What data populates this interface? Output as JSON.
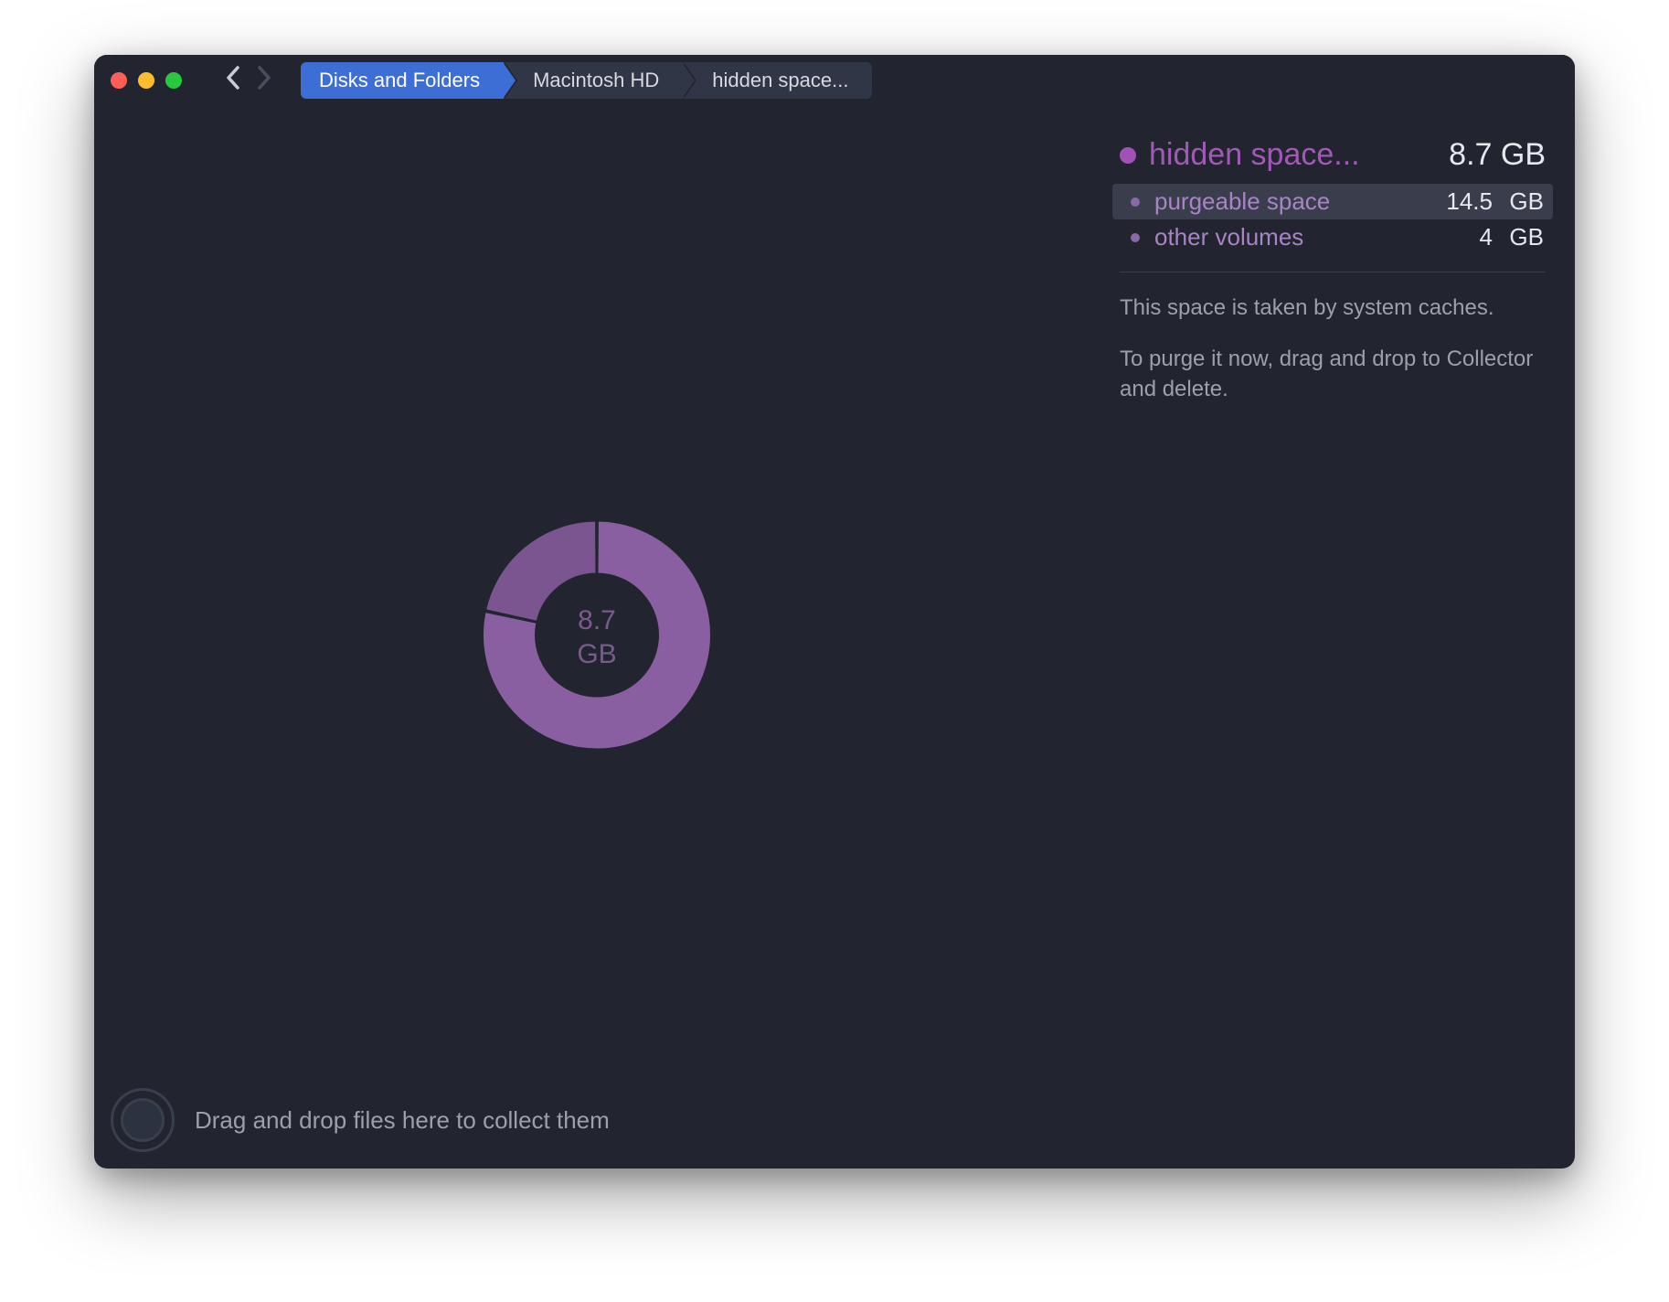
{
  "breadcrumb": {
    "items": [
      {
        "label": "Disks and Folders",
        "active": true
      },
      {
        "label": "Macintosh HD",
        "active": false
      },
      {
        "label": "hidden space...",
        "active": false
      }
    ]
  },
  "chart_center": {
    "value": "8.7",
    "unit": "GB"
  },
  "chart_data": {
    "type": "pie",
    "title": "hidden space",
    "total_label": "8.7 GB",
    "series": [
      {
        "name": "purgeable space",
        "value": 14.5,
        "unit": "GB",
        "color": "#8a5fa1"
      },
      {
        "name": "other volumes",
        "value": 4.0,
        "unit": "GB",
        "color": "#7a5590"
      }
    ]
  },
  "segment_colors": {
    "a": "#8a5fa1",
    "b": "#7a5590"
  },
  "sidebar": {
    "header": {
      "name": "hidden space...",
      "size": "8.7 GB"
    },
    "items": [
      {
        "name": "purgeable space",
        "size_num": "14.5",
        "size_unit": "GB",
        "selected": true
      },
      {
        "name": "other volumes",
        "size_num": "4",
        "size_unit": "GB",
        "selected": false
      }
    ],
    "description": {
      "line1": "This space is taken by system caches.",
      "line2": "To purge it now, drag and drop to Collector and delete."
    }
  },
  "collector": {
    "hint": "Drag and drop files here to collect them"
  }
}
